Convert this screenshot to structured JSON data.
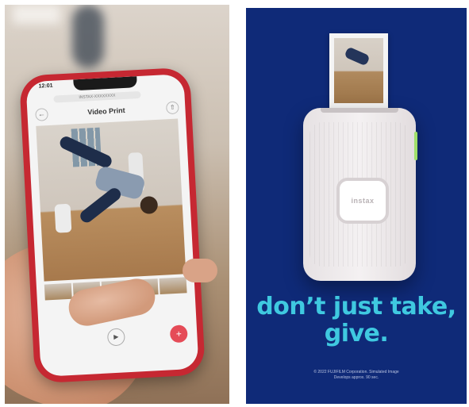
{
  "phone_app": {
    "status_time": "12:01",
    "device_label": "INSTAX-XXXXXXXX",
    "screen_title": "Video Print",
    "play_icon": "play-icon",
    "print_icon": "print-plus-icon"
  },
  "ad": {
    "printer_brand": "instax",
    "tagline_line1": "don’t just take,",
    "tagline_line2": "give.",
    "copyright_line1": "© 2022 FUJIFILM Corporation. Simulated Image",
    "copyright_line2": "Develops approx. 90 sec.",
    "colors": {
      "background": "#0f2a78",
      "tagline": "#3fc9e0",
      "phone_case": "#c62832",
      "print_button": "#e54b57"
    }
  }
}
